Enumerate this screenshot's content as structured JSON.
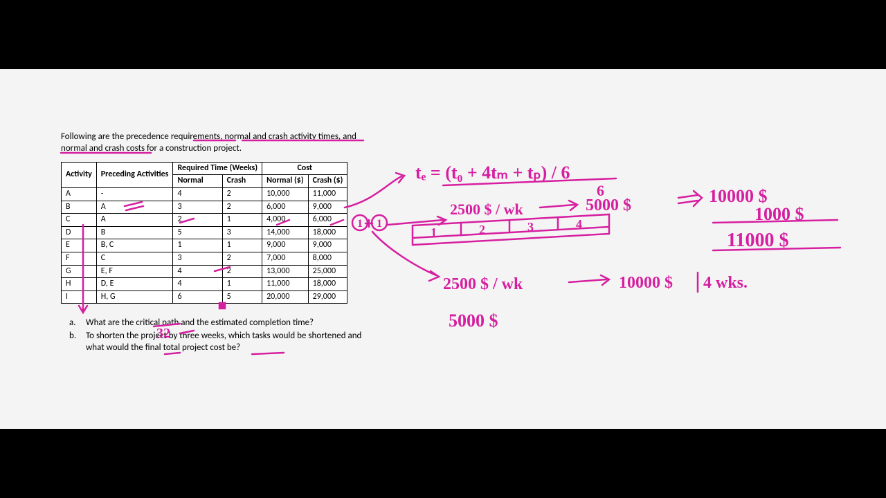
{
  "intro_line1": "Following are the precedence requirements, normal and crash activity times, and",
  "intro_line2": "normal and crash costs for a construction project.",
  "headers": {
    "activity": "Activity",
    "preceding": "Preceding Activities",
    "required": "Required Time (Weeks)",
    "cost": "Cost",
    "normal_time": "Normal",
    "crash_time": "Crash",
    "normal_cost": "Normal ($)",
    "crash_cost": "Crash ($)"
  },
  "rows": [
    {
      "act": "A",
      "pre": "-",
      "nt": "4",
      "ct": "2",
      "nc": "10,000",
      "cc": "11,000"
    },
    {
      "act": "B",
      "pre": "A",
      "nt": "3",
      "ct": "2",
      "nc": "6,000",
      "cc": "9,000"
    },
    {
      "act": "C",
      "pre": "A",
      "nt": "2",
      "ct": "1",
      "nc": "4,000",
      "cc": "6,000"
    },
    {
      "act": "D",
      "pre": "B",
      "nt": "5",
      "ct": "3",
      "nc": "14,000",
      "cc": "18,000"
    },
    {
      "act": "E",
      "pre": "B, C",
      "nt": "1",
      "ct": "1",
      "nc": "9,000",
      "cc": "9,000"
    },
    {
      "act": "F",
      "pre": "C",
      "nt": "3",
      "ct": "2",
      "nc": "7,000",
      "cc": "8,000"
    },
    {
      "act": "G",
      "pre": "E, F",
      "nt": "4",
      "ct": "2",
      "nc": "13,000",
      "cc": "25,000"
    },
    {
      "act": "H",
      "pre": "D, E",
      "nt": "4",
      "ct": "1",
      "nc": "11,000",
      "cc": "18,000"
    },
    {
      "act": "I",
      "pre": "H, G",
      "nt": "6",
      "ct": "5",
      "nc": "20,000",
      "cc": "29,000"
    }
  ],
  "qa_label": "a.",
  "qa_text": "What are the critical path and the estimated completion time?",
  "qb_label": "b.",
  "qb_text1": "To shorten the project by three weeks, which tasks would be shortened and",
  "qb_text2": "what would the final total project cost be?",
  "annot": {
    "formula": "tₑ = (t₀ + 4tₘ + tₚ) / 6",
    "sum32": "32",
    "rate1": "2500 $ / wk",
    "to5000": "5000 $",
    "right10000": "10000 $",
    "right1000": "1000 $",
    "right11000": "11000 $",
    "rate2": "2500 $ / wk",
    "to10000": "10000 $",
    "per4wks": "4 wks.",
    "val5000": "5000 $",
    "b1": "1",
    "b2": "2",
    "b3": "3",
    "b4": "4",
    "circ1": "1",
    "circ2": "1"
  }
}
